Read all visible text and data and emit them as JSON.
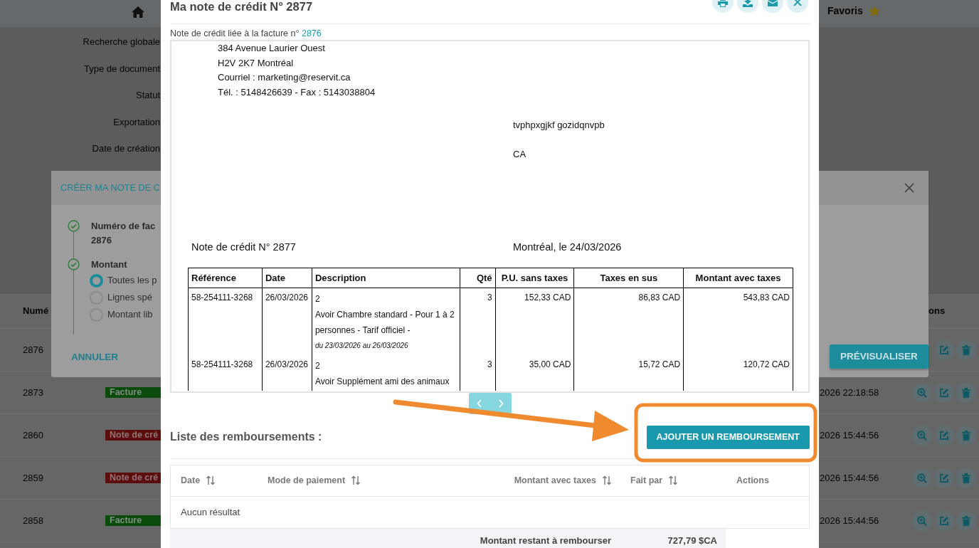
{
  "navbar": {
    "favorites": "Favoris"
  },
  "filters": [
    "Recherche globale",
    "Type de document",
    "Statut",
    "Exportation",
    "Date de création"
  ],
  "list": {
    "columns": [
      "Numé",
      "ons"
    ],
    "rows": [
      {
        "number": "2876",
        "actions": [
          {
            "kind": "edit"
          },
          {
            "kind": "delete"
          }
        ]
      },
      {
        "number": "2873",
        "badge": {
          "text": "Facture",
          "kind": "invoice"
        },
        "date": "2026 22:18:58",
        "actions": [
          {
            "kind": "view"
          },
          {
            "kind": "edit"
          },
          {
            "kind": "delete"
          }
        ]
      },
      {
        "number": "2860",
        "badge": {
          "text": "Note de cré",
          "kind": "credit"
        },
        "date": "2026 15:44:56",
        "actions": [
          {
            "kind": "view"
          },
          {
            "kind": "edit"
          },
          {
            "kind": "delete"
          }
        ]
      },
      {
        "number": "2859",
        "badge": {
          "text": "Note de cré",
          "kind": "credit"
        },
        "date": "2026 15:44:56",
        "actions": [
          {
            "kind": "view"
          },
          {
            "kind": "edit"
          },
          {
            "kind": "delete"
          }
        ]
      },
      {
        "number": "2858",
        "badge": {
          "text": "Facture",
          "kind": "invoice"
        },
        "date": "2026 15:44:56",
        "actions": [
          {
            "kind": "view"
          },
          {
            "kind": "edit"
          },
          {
            "kind": "delete"
          }
        ]
      }
    ]
  },
  "back_modal": {
    "title": "CRÉER MA NOTE DE C",
    "steps": [
      {
        "title": "Numéro de fac",
        "value": "2876",
        "done": true
      },
      {
        "title": "Montant",
        "done": true,
        "options": [
          {
            "label": "Toutes les p",
            "selected": true
          },
          {
            "label": "Lignes spé",
            "selected": false
          },
          {
            "label": "Montant lib",
            "selected": false
          }
        ]
      }
    ],
    "cancel_button": "ANNULER",
    "preview_button": "PRÉVISUALISER"
  },
  "modal": {
    "title": "Ma note de crédit N° 2877",
    "actions": [
      {
        "kind": "print"
      },
      {
        "kind": "download"
      },
      {
        "kind": "mail"
      },
      {
        "kind": "close"
      }
    ],
    "linked_invoice": {
      "label": "Note de crédit liée à la facture n°",
      "link": "2876"
    },
    "document": {
      "company_lines": [
        "384 Avenue Laurier Ouest",
        "H2V 2K7 Montréal",
        "Courriel : marketing@reservit.ca",
        "Tél. : 5148426639 - Fax : 5143038804"
      ],
      "client_lines": [
        "tvphpxgjkf gozidqnvpb",
        "CA"
      ],
      "title": "Note de crédit N° 2877",
      "place_date": "Montréal, le 24/03/2026",
      "table": {
        "columns": [
          "Référence",
          "Date",
          "Description",
          "Qté",
          "P.U. sans taxes",
          "Taxes en sus",
          "Montant avec taxes"
        ],
        "rows": [
          {
            "reference": "58-254111-3268",
            "date": "26/03/2026",
            "quantity_line": "2",
            "description": "Avoir Chambre standard - Pour 1 à 2 personnes - Tarif officiel -",
            "period": "du 23/03/2026 au 26/03/2026",
            "qty": "3",
            "unit_price": "152,33 CAD",
            "taxes": "86,83 CAD",
            "total": "543,83 CAD"
          },
          {
            "reference": "58-254111-3268",
            "date": "26/03/2026",
            "quantity_line": "2",
            "description": "Avoir Supplément ami des animaux",
            "qty": "3",
            "unit_price": "35,00 CAD",
            "taxes": "15,72 CAD",
            "total": "120,72 CAD"
          }
        ]
      }
    },
    "refunds": {
      "title": "Liste des remboursements :",
      "add_button": "AJOUTER UN REMBOURSEMENT",
      "columns": [
        {
          "label": "Date",
          "sortable": true
        },
        {
          "label": "Mode de paiement",
          "sortable": true
        },
        {
          "label": "Montant avec taxes",
          "sortable": true
        },
        {
          "label": "Fait par",
          "sortable": true
        },
        {
          "label": "Actions",
          "sortable": false
        }
      ],
      "empty_text": "Aucun résultat",
      "remaining_label": "Montant restant à rembourser",
      "remaining_value": "727,79 $CA"
    }
  }
}
